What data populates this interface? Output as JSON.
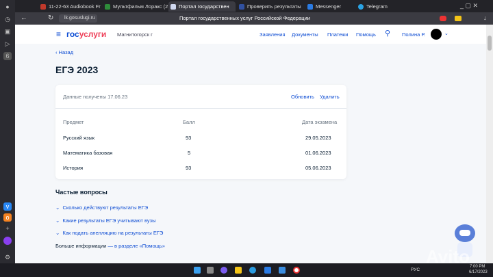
{
  "browser": {
    "tabs": [
      {
        "label": "11-22-63 Audiobook Fr",
        "color": "#c0392b"
      },
      {
        "label": "Мультфильм Лоракс (2",
        "color": "#2e8b3a"
      },
      {
        "label": "Портал государствен",
        "color": "#d0d8f0",
        "active": true
      },
      {
        "label": "Проверить результаты",
        "color": "#3050a0"
      },
      {
        "label": "Messenger",
        "color": "#2a7be4"
      },
      {
        "label": "Telegram",
        "color": "#2aa3e4"
      }
    ],
    "url": "lk.gosuslugi.ru",
    "page_title": "Портал государственных услуг Российской Федерации"
  },
  "header": {
    "logo_a": "гос",
    "logo_b": "услуги",
    "city": "Магнитогорск г",
    "nav": [
      "Заявления",
      "Документы",
      "Платежи",
      "Помощь"
    ],
    "user": "Полина Р."
  },
  "main": {
    "back": "Назад",
    "title": "ЕГЭ 2023",
    "card": {
      "received": "Данные получены 17.06.23",
      "refresh": "Обновить",
      "delete": "Удалить",
      "columns": [
        "Предмет",
        "Балл",
        "Дата экзамена"
      ],
      "rows": [
        [
          "Русский язык",
          "93",
          "29.05.2023"
        ],
        [
          "Математика базовая",
          "5",
          "01.06.2023"
        ],
        [
          "История",
          "93",
          "05.06.2023"
        ]
      ]
    },
    "faq": {
      "title": "Частые вопросы",
      "items": [
        "Сколько действуют результаты ЕГЭ",
        "Какие результаты ЕГЭ учитывают вузы",
        "Как подать апелляцию на результаты ЕГЭ"
      ],
      "more": "Больше информации",
      "more_link": "— в разделе «Помощь»"
    }
  },
  "taskbar": {
    "lang": "РУС",
    "time": "7:00 PM",
    "date": "6/17/2023"
  },
  "watermark": "Avito",
  "colors": {
    "brand_blue": "#0d4cd3",
    "brand_red": "#ee3f58",
    "page_bg": "#f5f7fa"
  }
}
